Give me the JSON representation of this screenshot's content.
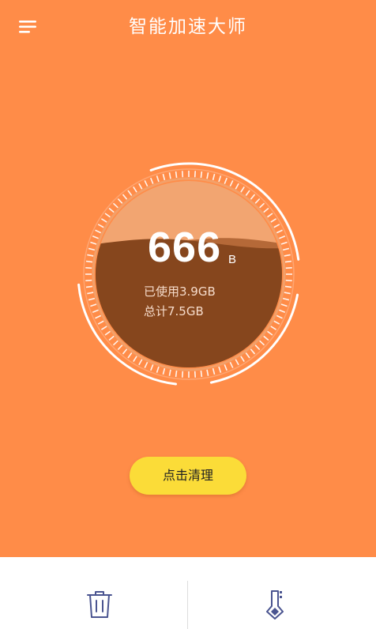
{
  "header": {
    "title": "智能加速大师",
    "menu_icon": "hamburger-menu-icon"
  },
  "memory": {
    "used_value": "666",
    "used_unit": "B",
    "used_text": "已使用3.9GB",
    "total_text": "总计7.5GB",
    "used_fraction": 0.52
  },
  "actions": {
    "clean_label": "点击清理"
  },
  "bottom_tabs": [
    {
      "icon": "trash-icon"
    },
    {
      "icon": "thermometer-icon"
    }
  ],
  "colors": {
    "background": "#ff8c48",
    "button": "#fbdc38",
    "liquid": "#8a461c",
    "icon": "#4a5490"
  }
}
